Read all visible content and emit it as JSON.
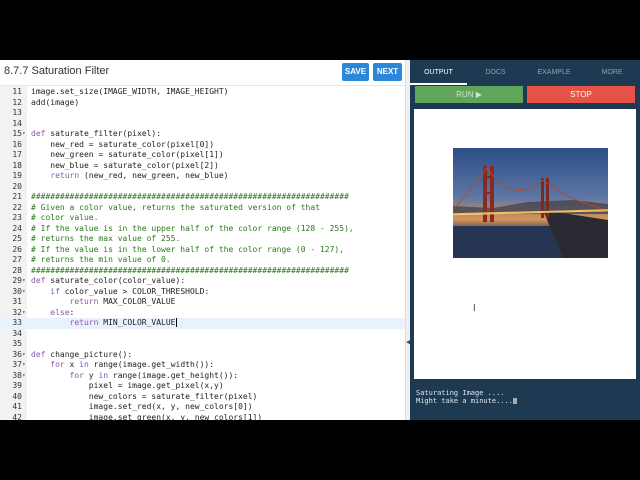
{
  "header": {
    "title": "8.7.7 Saturation Filter",
    "save_label": "SAVE",
    "next_label": "NEXT"
  },
  "editor": {
    "lines": [
      {
        "n": "11",
        "fold": "",
        "text": "image.set_size(IMAGE_WIDTH, IMAGE_HEIGHT)",
        "kind": "code"
      },
      {
        "n": "12",
        "fold": "",
        "text": "add(image)",
        "kind": "code"
      },
      {
        "n": "13",
        "fold": "",
        "text": "",
        "kind": "code"
      },
      {
        "n": "14",
        "fold": "",
        "text": "",
        "kind": "code"
      },
      {
        "n": "15",
        "fold": "▾",
        "text": "def saturate_filter(pixel):",
        "kind": "def"
      },
      {
        "n": "16",
        "fold": "",
        "text": "    new_red = saturate_color(pixel[0])",
        "kind": "code"
      },
      {
        "n": "17",
        "fold": "",
        "text": "    new_green = saturate_color(pixel[1])",
        "kind": "code"
      },
      {
        "n": "18",
        "fold": "",
        "text": "    new_blue = saturate_color(pixel[2])",
        "kind": "code"
      },
      {
        "n": "19",
        "fold": "",
        "text": "    return (new_red, new_green, new_blue)",
        "kind": "ret"
      },
      {
        "n": "20",
        "fold": "",
        "text": "",
        "kind": "code"
      },
      {
        "n": "21",
        "fold": "",
        "text": "##################################################################",
        "kind": "comment"
      },
      {
        "n": "22",
        "fold": "",
        "text": "# Given a color value, returns the saturated version of that",
        "kind": "comment"
      },
      {
        "n": "23",
        "fold": "",
        "text": "# color value.",
        "kind": "comment"
      },
      {
        "n": "24",
        "fold": "",
        "text": "# If the value is in the upper half of the color range (128 - 255),",
        "kind": "comment"
      },
      {
        "n": "25",
        "fold": "",
        "text": "# returns the max value of 255.",
        "kind": "comment"
      },
      {
        "n": "26",
        "fold": "",
        "text": "# If the value is in the lower half of the color range (0 - 127),",
        "kind": "comment"
      },
      {
        "n": "27",
        "fold": "",
        "text": "# returns the min value of 0.",
        "kind": "comment"
      },
      {
        "n": "28",
        "fold": "",
        "text": "##################################################################",
        "kind": "comment"
      },
      {
        "n": "29",
        "fold": "▾",
        "text": "def saturate_color(color_value):",
        "kind": "def"
      },
      {
        "n": "30",
        "fold": "▾",
        "text": "    if color_value > COLOR_THRESHOLD:",
        "kind": "if"
      },
      {
        "n": "31",
        "fold": "",
        "text": "        return MAX_COLOR_VALUE",
        "kind": "ret"
      },
      {
        "n": "32",
        "fold": "▾",
        "text": "    else:",
        "kind": "else"
      },
      {
        "n": "33",
        "fold": "",
        "text": "        return MIN_COLOR_VALUE",
        "kind": "ret",
        "active": true
      },
      {
        "n": "34",
        "fold": "",
        "text": "",
        "kind": "code"
      },
      {
        "n": "35",
        "fold": "",
        "text": "",
        "kind": "code"
      },
      {
        "n": "36",
        "fold": "▾",
        "text": "def change_picture():",
        "kind": "def"
      },
      {
        "n": "37",
        "fold": "▾",
        "text": "    for x in range(image.get_width()):",
        "kind": "for"
      },
      {
        "n": "38",
        "fold": "▾",
        "text": "        for y in range(image.get_height()):",
        "kind": "for"
      },
      {
        "n": "39",
        "fold": "",
        "text": "            pixel = image.get_pixel(x,y)",
        "kind": "code"
      },
      {
        "n": "40",
        "fold": "",
        "text": "            new_colors = saturate_filter(pixel)",
        "kind": "code"
      },
      {
        "n": "41",
        "fold": "",
        "text": "            image.set_red(x, y, new_colors[0])",
        "kind": "code"
      },
      {
        "n": "42",
        "fold": "",
        "text": "            image.set_green(x, y, new_colors[1])",
        "kind": "code"
      }
    ]
  },
  "right_panel": {
    "tabs": [
      {
        "label": "OUTPUT",
        "active": true
      },
      {
        "label": "DOCS",
        "active": false
      },
      {
        "label": "EXAMPLE",
        "active": false
      },
      {
        "label": "MORE",
        "active": false
      }
    ],
    "run_label": "RUN ▶",
    "stop_label": "STOP",
    "console": {
      "line1": "Saturating Image ....",
      "line2": "Might take a minute...."
    }
  },
  "icons": {
    "divider": "chevron-left-icon",
    "camera": "camera-icon",
    "cursor": "text-cursor-icon"
  },
  "colors": {
    "button_blue": "#2b88d9",
    "run_green": "#5fa55a",
    "stop_red": "#e55347",
    "panel_dark": "#1e3a52"
  }
}
